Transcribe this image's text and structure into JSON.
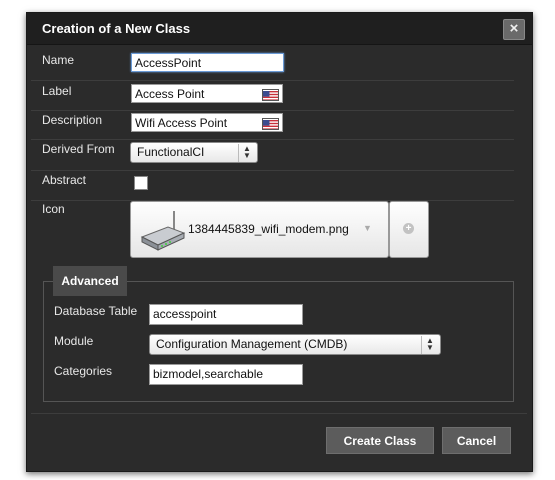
{
  "dialog": {
    "title": "Creation of a New Class",
    "close_label": "×"
  },
  "form": {
    "name": {
      "label": "Name",
      "value": "AccessPoint"
    },
    "label": {
      "label": "Label",
      "value": "Access Point"
    },
    "description": {
      "label": "Description",
      "value": "Wifi Access Point"
    },
    "derived_from": {
      "label": "Derived From",
      "value": "FunctionalCI"
    },
    "abstract": {
      "label": "Abstract",
      "checked": false
    },
    "icon": {
      "label": "Icon",
      "value": "1384445839_wifi_modem.png",
      "caret": "▼",
      "add": "+"
    }
  },
  "advanced": {
    "legend": "Advanced",
    "database_table": {
      "label": "Database Table",
      "value": "accesspoint"
    },
    "module": {
      "label": "Module",
      "value": "Configuration Management (CMDB)"
    },
    "categories": {
      "label": "Categories",
      "value": "bizmodel,searchable"
    }
  },
  "buttons": {
    "create": "Create Class",
    "cancel": "Cancel"
  },
  "colors": {
    "dialog_bg": "#2b2b2b",
    "titlebar_bg": "#1f1f1f",
    "button_bg": "#5c5c5c"
  }
}
